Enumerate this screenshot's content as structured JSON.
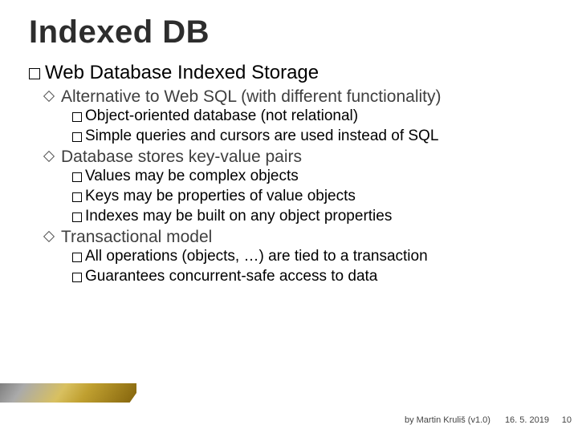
{
  "title": "Indexed DB",
  "heading": {
    "lead": "Web",
    "rest": " Database Indexed Storage"
  },
  "items": [
    {
      "label": "Alternative to Web SQL (with different functionality)",
      "sub": [
        "Object-oriented database (not relational)",
        "Simple queries and cursors are used instead of SQL"
      ]
    },
    {
      "label": "Database stores key-value pairs",
      "sub": [
        "Values may be complex objects",
        "Keys may be properties of value objects",
        "Indexes may be built on any object properties"
      ]
    },
    {
      "label": "Transactional model",
      "sub": [
        "All operations (objects, …) are tied to a transaction",
        "Guarantees concurrent-safe access to data"
      ]
    }
  ],
  "footer": {
    "author": "by Martin Kruliš (v1.0)",
    "date": "16. 5. 2019",
    "page": "10"
  }
}
